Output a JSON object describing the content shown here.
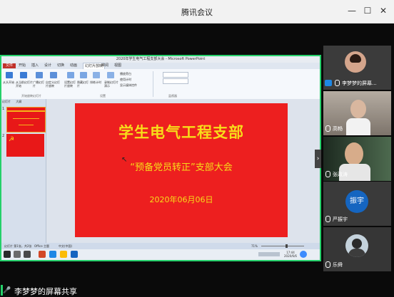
{
  "window": {
    "title": "腾讯会议",
    "min": "—",
    "max": "☐",
    "close": "✕"
  },
  "ppt": {
    "title": "2020年学生电气工程支部大会 - Microsoft PowerPoint",
    "tabs": [
      "文件",
      "开始",
      "插入",
      "设计",
      "切换",
      "动画",
      "幻灯片放映",
      "审阅",
      "视图"
    ],
    "ribbon": {
      "buttons": [
        "从头开始",
        "从当前幻灯片开始",
        "广播幻灯片",
        "自定义幻灯片放映",
        "设置幻灯片放映",
        "隐藏幻灯片",
        "排练计时",
        "录制幻灯片演示"
      ],
      "checks": [
        "播放旁白",
        "使用计时",
        "显示媒体控件"
      ],
      "groups": [
        "开始放映幻灯片",
        "设置",
        "监视器"
      ]
    },
    "panel_tabs": [
      "幻灯片",
      "大纲"
    ],
    "slide_numbers": [
      "1",
      "2"
    ],
    "status": [
      "幻灯片 第1张，共2张",
      "Office 主题",
      "中文(中国)"
    ],
    "zoom": "71%",
    "clock_time": "17:44",
    "clock_date": "2020/6/6"
  },
  "slide": {
    "title": "学生电气工程支部",
    "subtitle": "“预备党员转正”支部大会",
    "date": "2020年06月06日"
  },
  "share_label": "李梦梦的屏幕共享",
  "participants": [
    {
      "name": "李梦梦的屏幕..."
    },
    {
      "name": "高畅"
    },
    {
      "name": "张政涛"
    },
    {
      "name": "严振宇",
      "avatar_text": "振宇"
    },
    {
      "name": "乐舜"
    }
  ],
  "colors": {
    "accent": "#25d06a",
    "slide_bg": "#ed1f1f",
    "slide_text": "#f7dd1a",
    "avatar_blue": "#1565c0"
  }
}
